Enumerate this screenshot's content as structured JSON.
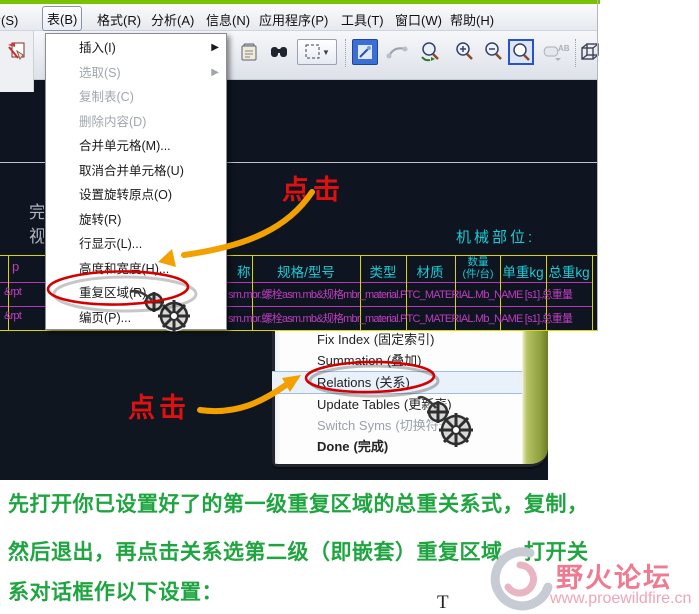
{
  "window": {
    "menubar": [
      "绘(S)",
      "表(B)",
      "格式(R)",
      "分析(A)",
      "信息(N)",
      "应用程序(P)",
      "工具(T)",
      "窗口(W)",
      "帮助(H)"
    ]
  },
  "table_menu": {
    "items": [
      {
        "label": "插入(I)",
        "state": "normal",
        "submenu": true
      },
      {
        "label": "选取(S)",
        "state": "disabled",
        "submenu": true
      },
      {
        "label": "复制表(C)",
        "state": "disabled"
      },
      {
        "label": "删除内容(D)",
        "state": "disabled"
      },
      {
        "label": "合并单元格(M)...",
        "state": "normal"
      },
      {
        "label": "取消合并单元格(U)",
        "state": "normal"
      },
      {
        "label": "设置旋转原点(O)",
        "state": "normal"
      },
      {
        "label": "旋转(R)",
        "state": "normal"
      },
      {
        "label": "行显示(L)...",
        "state": "normal"
      },
      {
        "label": "高度和宽度(H)...",
        "state": "normal"
      },
      {
        "label": "重复区域(R)...",
        "state": "normal",
        "annotated": true
      },
      {
        "label": "编页(P)...",
        "state": "normal"
      }
    ]
  },
  "cad": {
    "section_label": "机械部位:",
    "partial_glyphs": [
      "完",
      "视"
    ],
    "table": {
      "partial_header_left": "p",
      "partial_header": "称",
      "headers": [
        {
          "label": "规格/型号"
        },
        {
          "label": "类型"
        },
        {
          "label": "材质"
        },
        {
          "label": "数量",
          "sub": "(件/台)"
        },
        {
          "label": "单重kg"
        },
        {
          "label": "总重kg"
        }
      ],
      "row_prefix": "&rpt",
      "rows": [
        "sm.mbr.螺栓asm.mb&规格mbr_material.PTC_MATERIAL.Mb_NAME [s1].总重量",
        "sm.mbr.螺栓asm.mb&规格mbr_material.PTC_MATERIAL.Mb_NAME [s1].总重量"
      ]
    }
  },
  "popup_menu": {
    "items": [
      {
        "en": "Fix Index",
        "cn": "(固定索引)"
      },
      {
        "en": "Summation",
        "cn": "(叠加)"
      },
      {
        "en": "Relations",
        "cn": "(关系)",
        "highlighted": true
      },
      {
        "en": "Update Tables",
        "cn": "(更新表)"
      },
      {
        "en": "Switch Syms",
        "cn": "(切换符号)",
        "disabled": true
      },
      {
        "en": "Done",
        "cn": "(完成)",
        "bold": true
      }
    ]
  },
  "annotations": {
    "click1": "点击",
    "click2": "点击"
  },
  "footer": {
    "lines": [
      "先打开你已设置好了的第一级重复区域的总重关系式，复制，",
      "然后退出，再点击关系选第二级（即嵌套）重复区域，打开关",
      "系对话框作以下设置："
    ],
    "text_cursor": "T"
  },
  "watermark": {
    "title": "野火论坛",
    "url": "www.proewildfire.cn"
  },
  "colors": {
    "annotation_red": "#e01010",
    "arrow_orange": "#f2a100",
    "cad_background": "#0e1520",
    "table_border_yellow": "#d8d800",
    "table_text_cyan": "#1ec9d3",
    "row_text_magenta": "#c03cc0",
    "footer_green": "#1fa540",
    "watermark_pink": "#ee7b91",
    "menu_edge_green": "#8fa03e",
    "top_line_green": "#79c203"
  }
}
